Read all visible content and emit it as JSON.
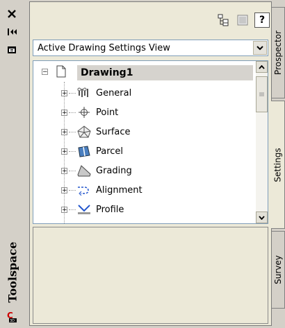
{
  "palette": {
    "title": "Toolspace",
    "close_icon": "close-icon",
    "autohide_icon": "autohide-icon",
    "properties_icon": "properties-icon",
    "c3d_icon": "civil3d-icon"
  },
  "toolbar": {
    "help_label": "?",
    "icons": [
      "tree-view-icon",
      "item-view-icon",
      "help-icon"
    ]
  },
  "view_selector": {
    "value": "Active Drawing Settings View"
  },
  "tree": {
    "root": "Drawing1",
    "items": [
      {
        "label": "General",
        "icon": "general-settings-icon"
      },
      {
        "label": "Point",
        "icon": "point-icon"
      },
      {
        "label": "Surface",
        "icon": "surface-icon"
      },
      {
        "label": "Parcel",
        "icon": "parcel-icon"
      },
      {
        "label": "Grading",
        "icon": "grading-icon"
      },
      {
        "label": "Alignment",
        "icon": "alignment-icon"
      },
      {
        "label": "Profile",
        "icon": "profile-icon"
      }
    ]
  },
  "tabs": [
    "Prospector",
    "Settings",
    "Survey"
  ],
  "active_tab": "Settings"
}
